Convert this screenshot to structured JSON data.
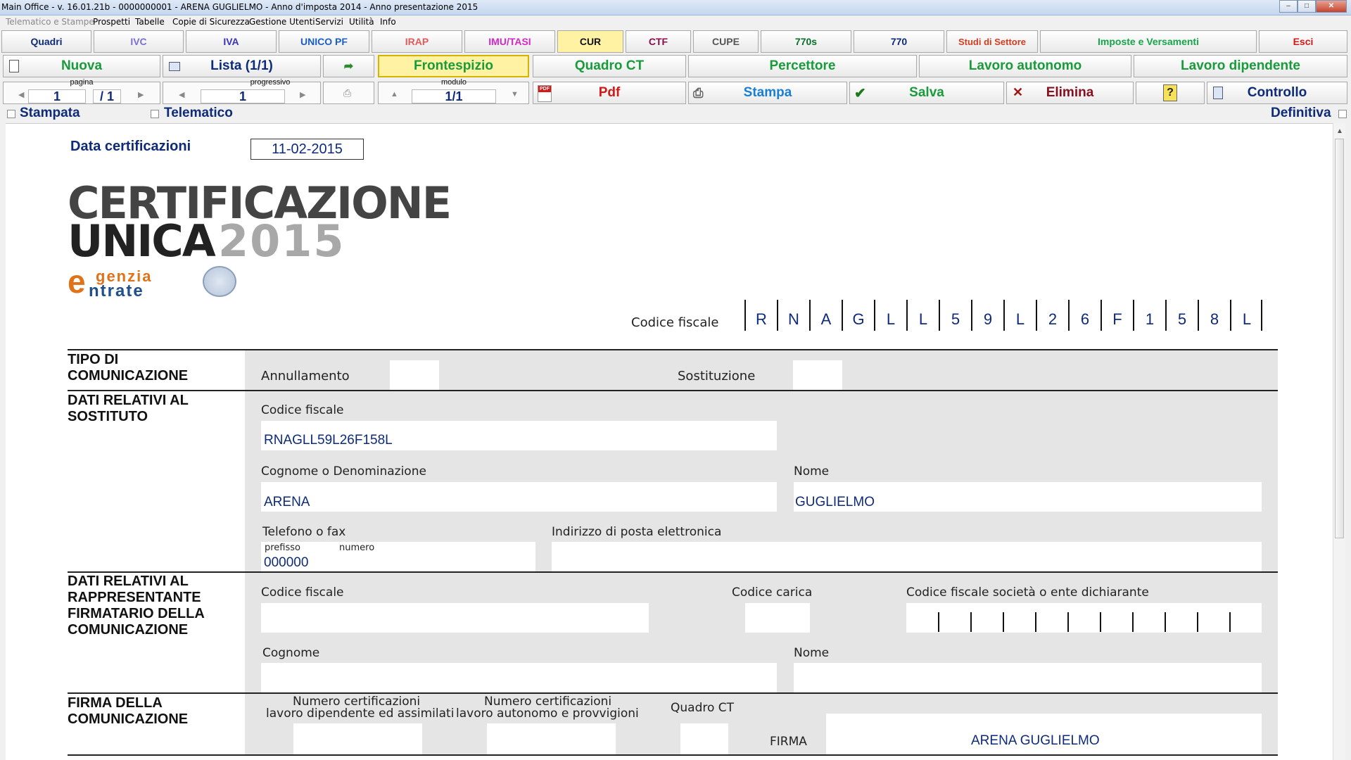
{
  "window": {
    "title": "Main Office - v. 16.01.21b - 0000000001 - ARENA GUGLIELMO - Anno d'imposta 2014 - Anno presentazione 2015"
  },
  "menu": [
    "Telematico e Stampe",
    "Prospetti",
    "Tabelle",
    "Copie di Sicurezza",
    "Gestione Utenti",
    "Servizi",
    "Utilità",
    "Info"
  ],
  "tabs": {
    "quadri": "Quadri",
    "ivc": "IVC",
    "iva": "IVA",
    "unico_pf": "UNICO PF",
    "irap": "IRAP",
    "imu": "IMU/TASI",
    "cur": "CUR",
    "ctf": "CTF",
    "cupe": "CUPE",
    "s770s": "770s",
    "s770": "770",
    "studi": "Studi di Settore",
    "imposte": "Imposte e Versamenti",
    "esci": "Esci"
  },
  "colors": {
    "ivc": "#7a6fd6",
    "irap": "#e35a5a",
    "imu": "#d428c9",
    "ctf": "#8e0c4a",
    "s770s": "#0a6f2a",
    "studi": "#d43c1f",
    "imposte": "#16a54a",
    "cur_bg": "#fff3a3",
    "green": "#1a9b3b",
    "blue_text": "#0e2b7a"
  },
  "actions": {
    "nuova": "Nuova",
    "lista": "Lista (1/1)",
    "frontespizio": "Frontespizio",
    "quadro_ct": "Quadro CT",
    "percettore": "Percettore",
    "lavoro_autonomo": "Lavoro autonomo",
    "lavoro_dipendente": "Lavoro dipendente",
    "pdf": "Pdf",
    "stampa": "Stampa",
    "salva": "Salva",
    "elimina": "Elimina",
    "controllo": "Controllo"
  },
  "nav": {
    "pagina_label": "pagina",
    "pagina_value": "1",
    "pagina_total": "/ 1",
    "progressivo_label": "progressivo",
    "progressivo_value": "1",
    "modulo_label": "modulo",
    "modulo_value": "1/1"
  },
  "flags": {
    "stampata": "Stampata",
    "telematico": "Telematico",
    "definitiva": "Definitiva"
  },
  "form": {
    "data_cert_label": "Data certificazioni",
    "data_cert_value": "11-02-2015",
    "logo_line1": "CERTIFICAZIONE",
    "logo_line2a": "UNICA",
    "logo_line2b": "2015",
    "agenzia_a": "genzia",
    "agenzia_b": "ntrate",
    "cf_label": "Codice fiscale",
    "cf_chars": [
      "R",
      "N",
      "A",
      "G",
      "L",
      "L",
      "5",
      "9",
      "L",
      "2",
      "6",
      "F",
      "1",
      "5",
      "8",
      "L"
    ],
    "tipo_title": "TIPO DI COMUNICAZIONE",
    "annullamento": "Annullamento",
    "sostituzione": "Sostituzione",
    "sostituto_title": "DATI RELATIVI AL SOSTITUTO",
    "sost_cf_label": "Codice fiscale",
    "sost_cf_value": "RNAGLL59L26F158L",
    "cognome_label": "Cognome o Denominazione",
    "cognome_value": "ARENA",
    "nome_label": "Nome",
    "nome_value": "GUGLIELMO",
    "telefono_label": "Telefono o fax",
    "prefisso_label": "prefisso",
    "numero_label": "numero",
    "telefono_value": "000000",
    "email_label": "Indirizzo di posta elettronica",
    "rappr_title": "DATI RELATIVI AL RAPPRESENTANTE FIRMATARIO DELLA COMUNICAZIONE",
    "rappr_cf_label": "Codice fiscale",
    "codice_carica_label": "Codice carica",
    "cf_societa_label": "Codice fiscale società o ente dichiarante",
    "rappr_cognome_label": "Cognome",
    "rappr_nome_label": "Nome",
    "firma_title": "FIRMA DELLA COMUNICAZIONE",
    "num_dip_label1": "Numero certificazioni",
    "num_dip_label2": "lavoro dipendente ed assimilati",
    "num_aut_label1": "Numero certificazioni",
    "num_aut_label2": "lavoro autonomo e provvigioni",
    "quadro_ct_label": "Quadro CT",
    "firma_label": "FIRMA",
    "firma_value": "ARENA GUGLIELMO"
  }
}
